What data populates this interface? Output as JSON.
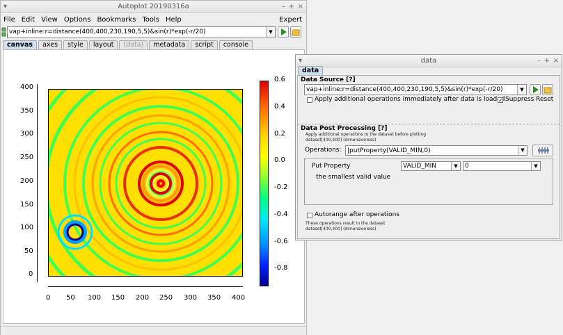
{
  "main_window": {
    "title": "Autoplot 20190316a",
    "menu": [
      "File",
      "Edit",
      "View",
      "Options",
      "Bookmarks",
      "Tools",
      "Help"
    ],
    "menu_right": "Expert",
    "uri": "vap+inline:r=distance(400,400,230,190,5,5)&sin(r)*exp(-r/20)",
    "tabs": [
      "canvas",
      "axes",
      "style",
      "layout",
      "(data)",
      "metadata",
      "script",
      "console"
    ],
    "active_tab": "canvas"
  },
  "plot": {
    "y_ticks": [
      "400",
      "350",
      "300",
      "250",
      "200",
      "150",
      "100",
      "50",
      "0"
    ],
    "x_ticks": [
      "0",
      "50",
      "100",
      "150",
      "200",
      "250",
      "300",
      "350",
      "400"
    ],
    "colorbar_ticks": [
      "0.6",
      "0.4",
      "0.2",
      "0.0",
      "-0.2",
      "-0.4",
      "-0.6",
      "-0.8"
    ]
  },
  "chart_data": {
    "type": "heatmap",
    "function": "r=distance(400,400,230,190,5,5)&sin(r)*exp(-r/20)",
    "xlim": [
      0,
      400
    ],
    "ylim": [
      0,
      400
    ],
    "zlim": [
      -0.9,
      0.6
    ],
    "x_ticks": [
      0,
      50,
      100,
      150,
      200,
      250,
      300,
      350,
      400
    ],
    "y_ticks": [
      0,
      50,
      100,
      150,
      200,
      250,
      300,
      350,
      400
    ],
    "colorbar_ticks": [
      0.6,
      0.4,
      0.2,
      0.0,
      -0.2,
      -0.4,
      -0.6,
      -0.8
    ],
    "center": [
      230,
      190
    ],
    "colormap": [
      "#000090",
      "#0020ff",
      "#0090ff",
      "#00e8ff",
      "#00ff80",
      "#90ff30",
      "#ffff00",
      "#ffd800",
      "#ff7000",
      "#e00000"
    ]
  },
  "data_window": {
    "title": "data",
    "tab": "data",
    "data_source_title": "Data Source [?]",
    "uri": "vap+inline:r=distance(400,400,230,190,5,5)&sin(r)*exp(-r/20)",
    "apply_ops_label": "Apply additional operations immediately after data is loaded",
    "suppress_reset_label": "Suppress Reset",
    "post_processing_title": "Data Post Processing [?]",
    "post_note_1": "Apply additional operations to the dataset before plotting",
    "post_note_2": "dataset[400,400] (dimensionless)",
    "operations_label": "Operations:",
    "operations_value": "|putProperty(VALID_MIN,0)",
    "put_property_label": "Put Property",
    "property_name": "VALID_MIN",
    "property_value": "0",
    "property_desc": "the smallest valid value",
    "autorange_label": "Autorange after operations",
    "result_note_1": "These operations result in the dataset",
    "result_note_2": "dataset[400,400] (dimensionless)"
  },
  "colors": {
    "active_tab": "#cfe0f2",
    "go_green": "#2e8b2e"
  }
}
